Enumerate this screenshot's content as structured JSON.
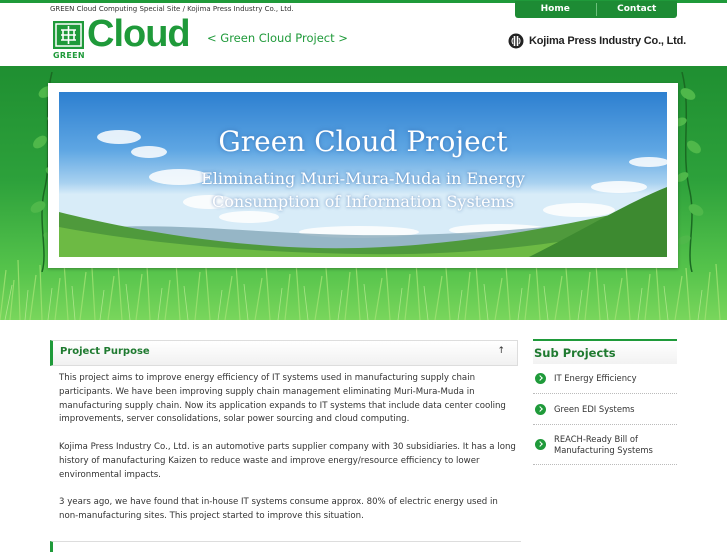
{
  "header": {
    "tagline": "GREEN Cloud Computing Special Site / Kojima Press Industry Co., Ltd.",
    "nav": [
      {
        "label": "Home"
      },
      {
        "label": "Contact"
      }
    ],
    "logo": {
      "green_text": "GREEN",
      "cloud_text": "Cloud"
    },
    "subtitle": "< Green Cloud Project >",
    "company": "Kojima Press Industry Co., Ltd."
  },
  "hero": {
    "title": "Green Cloud Project",
    "subtitle_line1": "Eliminating Muri-Mura-Muda in Energy",
    "subtitle_line2": "Consumption of Information Systems"
  },
  "main": {
    "section_title": "Project Purpose",
    "paragraphs": [
      "This project aims to improve energy efficiency of IT systems used in manufacturing supply chain participants. We have been improving supply chain management eliminating Muri-Mura-Muda in manufacturing supply chain. Now its application expands to IT systems that include data center cooling improvements, server consolidations, solar power sourcing and cloud computing.",
      "Kojima Press Industry Co., Ltd. is an automotive parts supplier company with 30 subsidiaries. It has a long history of manufacturing Kaizen to reduce waste and improve energy/resource efficiency to lower environmental impacts.",
      "3 years ago, we have found that in-house IT systems consume approx. 80% of electric energy used in non-manufacturing sites. This project started to improve this situation."
    ]
  },
  "sidebar": {
    "title": "Sub Projects",
    "items": [
      {
        "label": "IT Energy Efficiency"
      },
      {
        "label": "Green EDI Systems"
      },
      {
        "label": "REACH-Ready Bill of Manufacturing Systems"
      }
    ]
  },
  "colors": {
    "brand_green": "#1f9a3a",
    "text": "#333333"
  }
}
